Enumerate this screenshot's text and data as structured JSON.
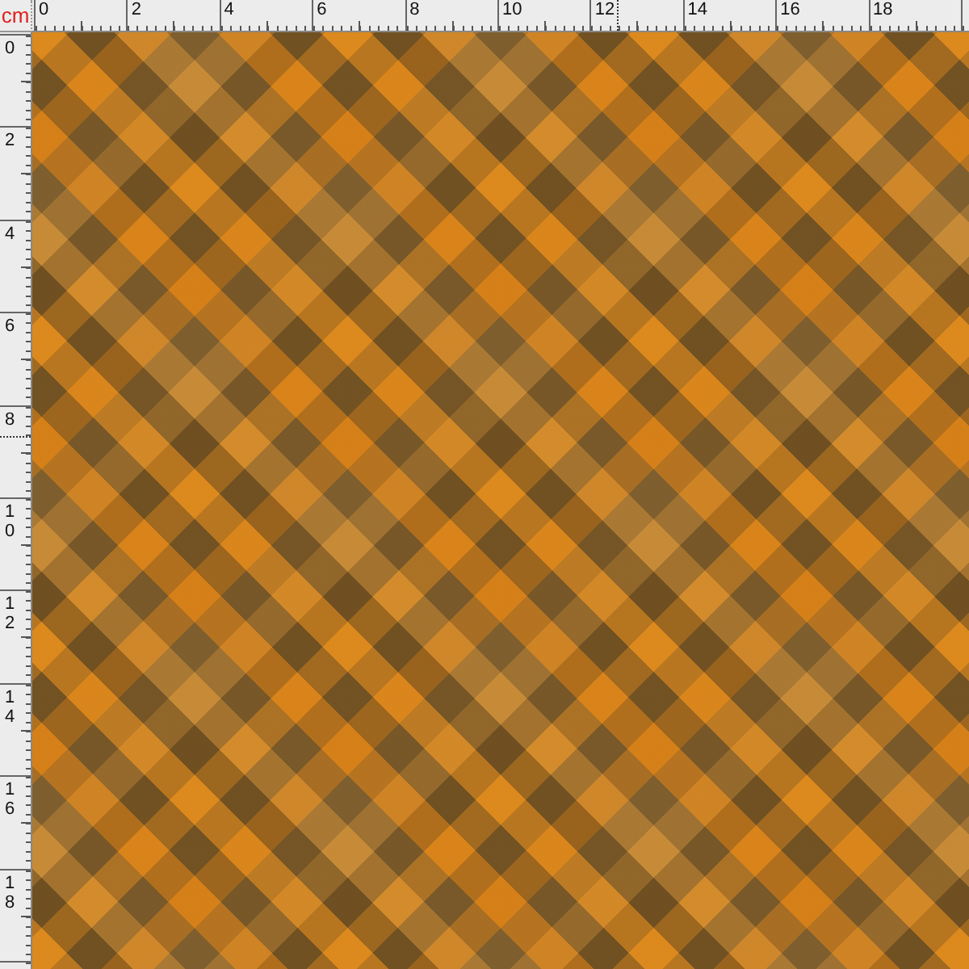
{
  "ruler_unit": "cm",
  "top_ruler": {
    "labels": [
      "0",
      "2",
      "4",
      "6",
      "8",
      "10",
      "12",
      "14",
      "16",
      "18"
    ]
  },
  "left_ruler": {
    "labels": [
      "0",
      "2",
      "4",
      "6",
      "8",
      "10",
      "12",
      "14",
      "16",
      "18"
    ]
  }
}
